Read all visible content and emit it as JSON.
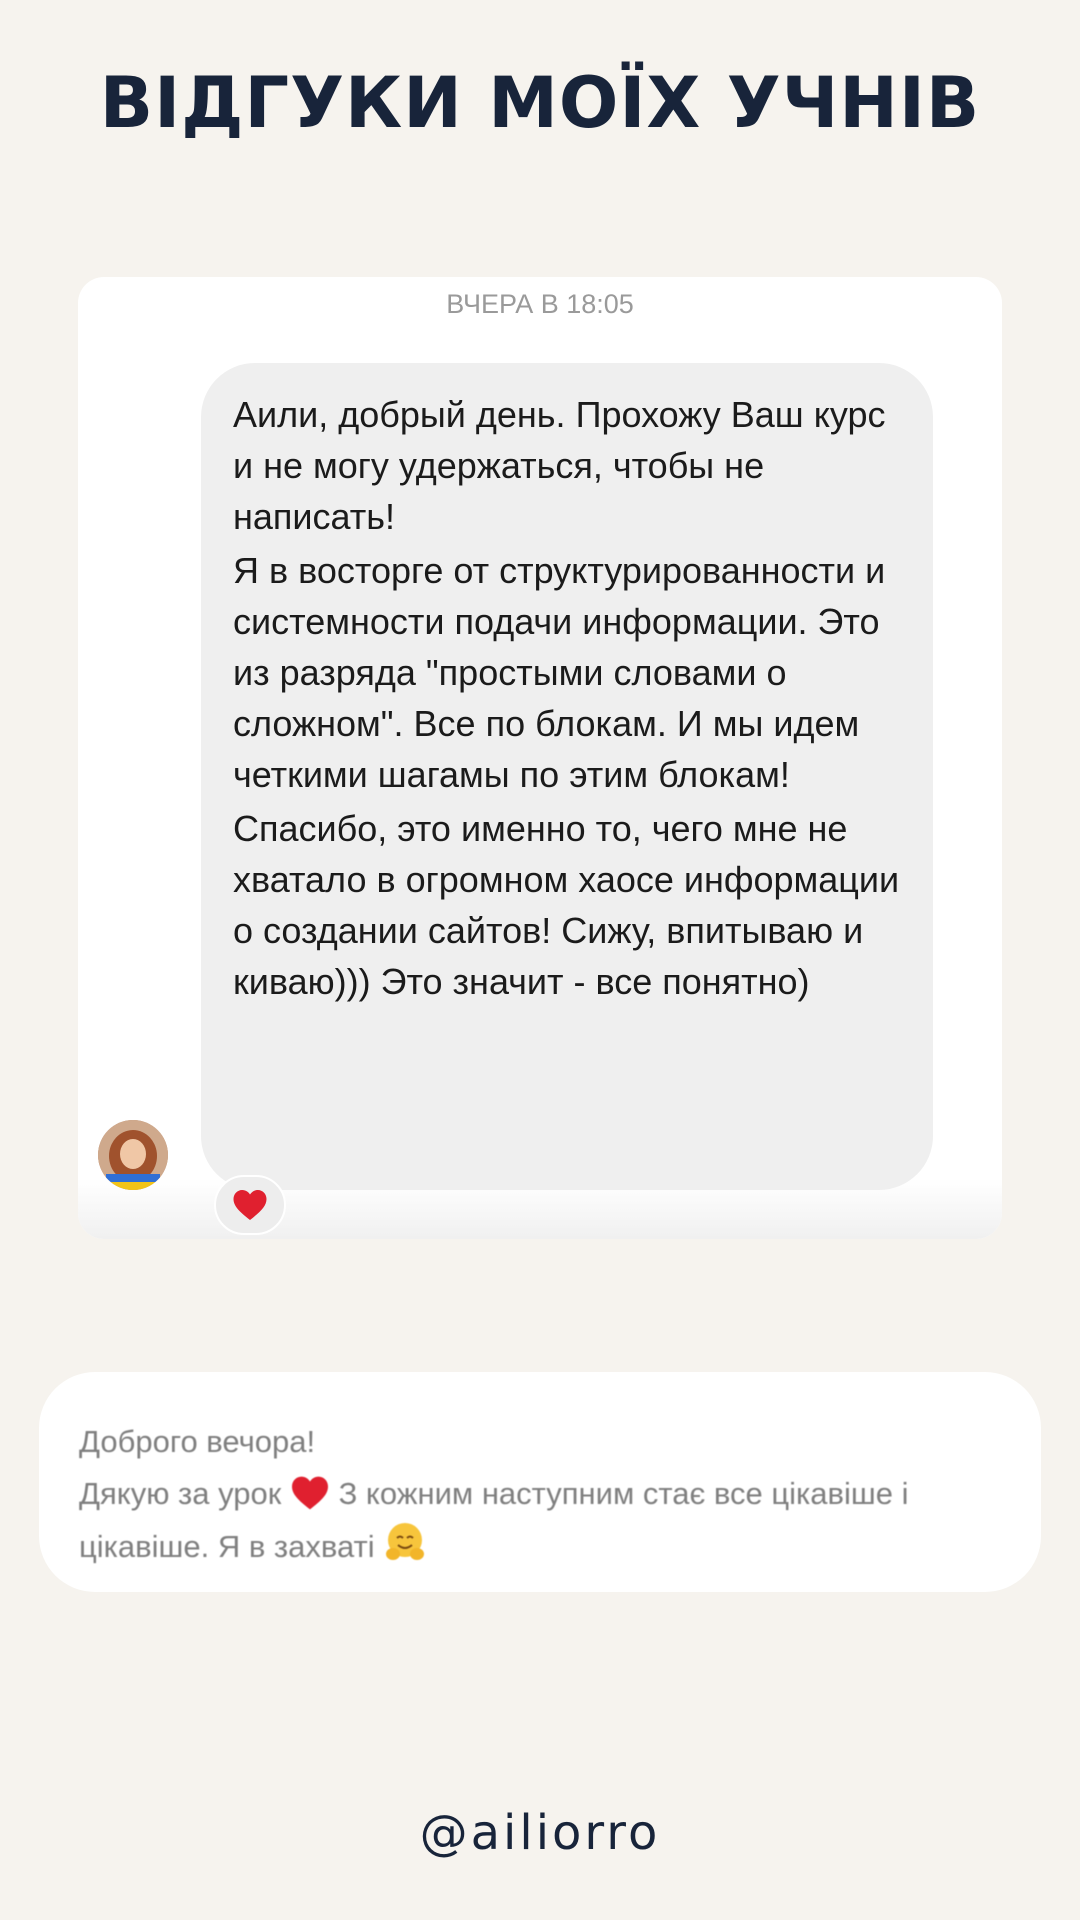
{
  "page": {
    "title": "ВІДГУКИ МОЇХ УЧНІВ",
    "handle": "@ailiorro"
  },
  "review1": {
    "timestamp": "ВЧЕРА В 18:05",
    "paragraphs": [
      "Аили, добрый день. Прохожу Ваш курс и не могу удержаться, чтобы не написать!",
      "Я в восторге от структурированности и системности подачи информации. Это из разряда \"простыми словами о сложном\". Все по блокам. И мы идем четкими шагамы по этим блокам!",
      "Спасибо, это именно то, чего мне не хватало в огромном хаосе информации о создании сайтов! Сижу, впитываю и киваю))) Это значит - все понятно)"
    ],
    "reaction_icon": "heart-icon",
    "avatar_icon": "avatar"
  },
  "review2": {
    "line1": "Доброго вечора!",
    "line2_start": "Дякую за урок",
    "line2_end": "З кожним наступним стає все цікавіше і",
    "line3": "цікавіше. Я в захваті",
    "icons": [
      "heart-icon",
      "hugging-face-icon"
    ]
  },
  "colors": {
    "background": "#f6f3ee",
    "title": "#18243a",
    "bubble": "#efefef",
    "heart": "#e0202f"
  }
}
